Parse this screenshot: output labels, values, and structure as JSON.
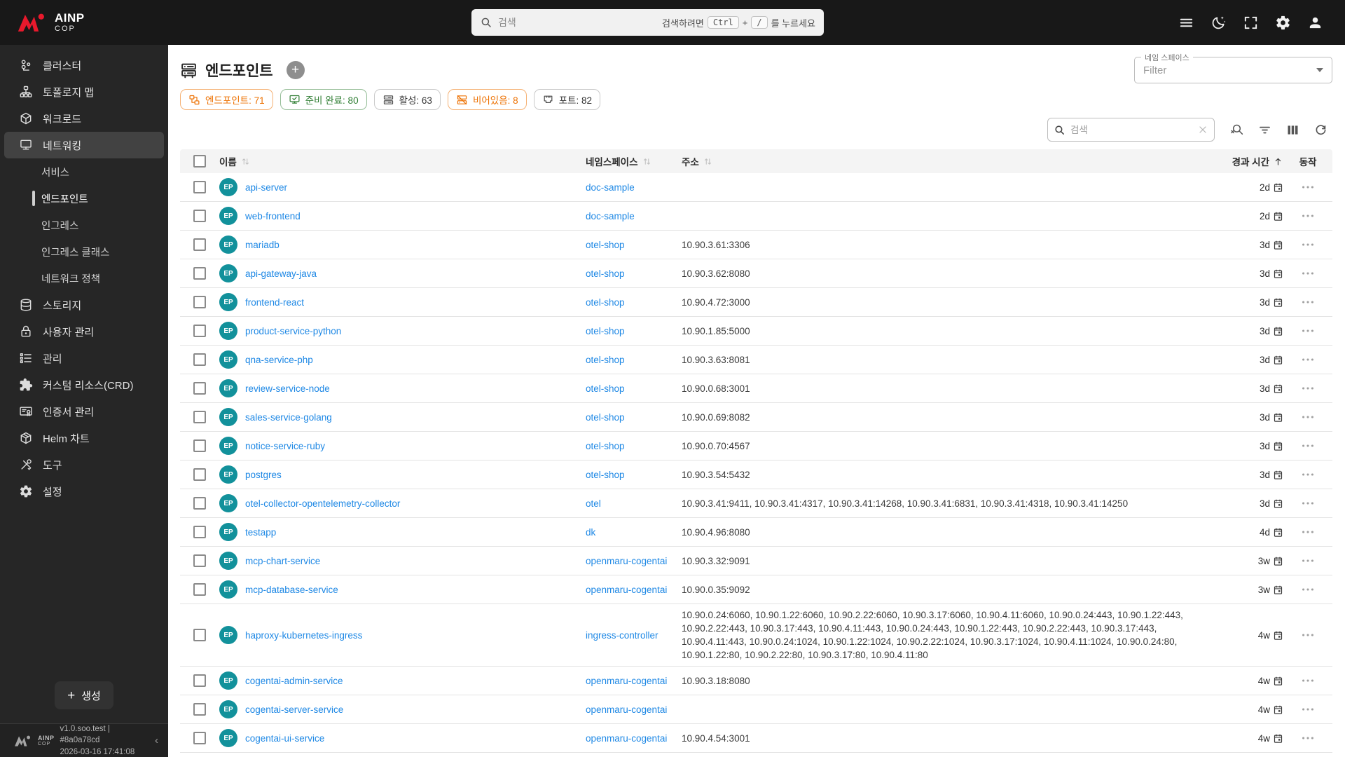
{
  "colors": {
    "brand_red": "#e8192c",
    "link_blue": "#1e88e5",
    "badge_teal": "#12919b",
    "orange": "#ed7102",
    "green": "#2e7d32"
  },
  "header": {
    "logo": {
      "title": "AINP",
      "subtitle": "COP"
    },
    "search": {
      "placeholder": "검색",
      "hint_prefix": "검색하려면",
      "key1": "Ctrl",
      "plus": "+",
      "key2": "/",
      "hint_suffix": "를 누르세요"
    },
    "icons": [
      "hamburger-menu-icon",
      "dark-mode-icon",
      "fullscreen-icon",
      "settings-icon",
      "account-icon"
    ]
  },
  "sidebar": {
    "items": [
      {
        "label": "클러스터",
        "icon": "cluster"
      },
      {
        "label": "토폴로지 맵",
        "icon": "topology"
      },
      {
        "label": "워크로드",
        "icon": "workload"
      },
      {
        "label": "네트워킹",
        "icon": "networking",
        "selected": true
      },
      {
        "label": "서비스",
        "sub": true
      },
      {
        "label": "엔드포인트",
        "sub": true,
        "active": true
      },
      {
        "label": "인그레스",
        "sub": true
      },
      {
        "label": "인그레스 클래스",
        "sub": true
      },
      {
        "label": "네트워크 정책",
        "sub": true
      },
      {
        "label": "스토리지",
        "icon": "storage"
      },
      {
        "label": "사용자 관리",
        "icon": "lock"
      },
      {
        "label": "관리",
        "icon": "checklist"
      },
      {
        "label": "커스텀 리소스(CRD)",
        "icon": "puzzle"
      },
      {
        "label": "인증서 관리",
        "icon": "certificate"
      },
      {
        "label": "Helm 차트",
        "icon": "helm"
      },
      {
        "label": "도구",
        "icon": "tools"
      },
      {
        "label": "설정",
        "icon": "gear-outline"
      }
    ],
    "create_label": "생성",
    "footer": {
      "version_line1": "v1.0.soo.test | #8a0a78cd",
      "version_line2": "2026-03-16 17:41:08"
    }
  },
  "main": {
    "title": "엔드포인트",
    "namespace_filter": {
      "label": "네임 스페이스",
      "value": "Filter"
    },
    "chips": [
      {
        "label": "엔드포인트",
        "value": "71",
        "style": "orange",
        "icon": "chip-endpoint"
      },
      {
        "label": "준비 완료",
        "value": "80",
        "style": "green",
        "icon": "chip-ready"
      },
      {
        "label": "활성",
        "value": "63",
        "style": "neutral",
        "icon": "chip-active"
      },
      {
        "label": "비어있음",
        "value": "8",
        "style": "orange",
        "icon": "chip-empty"
      },
      {
        "label": "포트",
        "value": "82",
        "style": "neutral",
        "icon": "chip-port"
      }
    ],
    "toolbar": {
      "search_placeholder": "검색"
    },
    "table": {
      "columns": [
        {
          "label": "이름",
          "sort": "none"
        },
        {
          "label": "네임스페이스",
          "sort": "none"
        },
        {
          "label": "주소",
          "sort": "none"
        },
        {
          "label": "경과 시간",
          "sort": "asc"
        },
        {
          "label": "동작"
        }
      ],
      "badge": "EP",
      "rows": [
        {
          "name": "api-server",
          "namespace": "doc-sample",
          "address": "",
          "age": "2d"
        },
        {
          "name": "web-frontend",
          "namespace": "doc-sample",
          "address": "",
          "age": "2d"
        },
        {
          "name": "mariadb",
          "namespace": "otel-shop",
          "address": "10.90.3.61:3306",
          "age": "3d"
        },
        {
          "name": "api-gateway-java",
          "namespace": "otel-shop",
          "address": "10.90.3.62:8080",
          "age": "3d"
        },
        {
          "name": "frontend-react",
          "namespace": "otel-shop",
          "address": "10.90.4.72:3000",
          "age": "3d"
        },
        {
          "name": "product-service-python",
          "namespace": "otel-shop",
          "address": "10.90.1.85:5000",
          "age": "3d"
        },
        {
          "name": "qna-service-php",
          "namespace": "otel-shop",
          "address": "10.90.3.63:8081",
          "age": "3d"
        },
        {
          "name": "review-service-node",
          "namespace": "otel-shop",
          "address": "10.90.0.68:3001",
          "age": "3d"
        },
        {
          "name": "sales-service-golang",
          "namespace": "otel-shop",
          "address": "10.90.0.69:8082",
          "age": "3d"
        },
        {
          "name": "notice-service-ruby",
          "namespace": "otel-shop",
          "address": "10.90.0.70:4567",
          "age": "3d"
        },
        {
          "name": "postgres",
          "namespace": "otel-shop",
          "address": "10.90.3.54:5432",
          "age": "3d"
        },
        {
          "name": "otel-collector-opentelemetry-collector",
          "namespace": "otel",
          "address": "10.90.3.41:9411, 10.90.3.41:4317, 10.90.3.41:14268, 10.90.3.41:6831, 10.90.3.41:4318, 10.90.3.41:14250",
          "age": "3d"
        },
        {
          "name": "testapp",
          "namespace": "dk",
          "address": "10.90.4.96:8080",
          "age": "4d"
        },
        {
          "name": "mcp-chart-service",
          "namespace": "openmaru-cogentai",
          "address": "10.90.3.32:9091",
          "age": "3w"
        },
        {
          "name": "mcp-database-service",
          "namespace": "openmaru-cogentai",
          "address": "10.90.0.35:9092",
          "age": "3w"
        },
        {
          "name": "haproxy-kubernetes-ingress",
          "namespace": "ingress-controller",
          "address": "10.90.0.24:6060, 10.90.1.22:6060, 10.90.2.22:6060, 10.90.3.17:6060, 10.90.4.11:6060, 10.90.0.24:443, 10.90.1.22:443, 10.90.2.22:443, 10.90.3.17:443, 10.90.4.11:443, 10.90.0.24:443, 10.90.1.22:443, 10.90.2.22:443, 10.90.3.17:443, 10.90.4.11:443, 10.90.0.24:1024, 10.90.1.22:1024, 10.90.2.22:1024, 10.90.3.17:1024, 10.90.4.11:1024, 10.90.0.24:80, 10.90.1.22:80, 10.90.2.22:80, 10.90.3.17:80, 10.90.4.11:80",
          "age": "4w"
        },
        {
          "name": "cogentai-admin-service",
          "namespace": "openmaru-cogentai",
          "address": "10.90.3.18:8080",
          "age": "4w"
        },
        {
          "name": "cogentai-server-service",
          "namespace": "openmaru-cogentai",
          "address": "",
          "age": "4w"
        },
        {
          "name": "cogentai-ui-service",
          "namespace": "openmaru-cogentai",
          "address": "10.90.4.54:3001",
          "age": "4w"
        }
      ]
    }
  }
}
